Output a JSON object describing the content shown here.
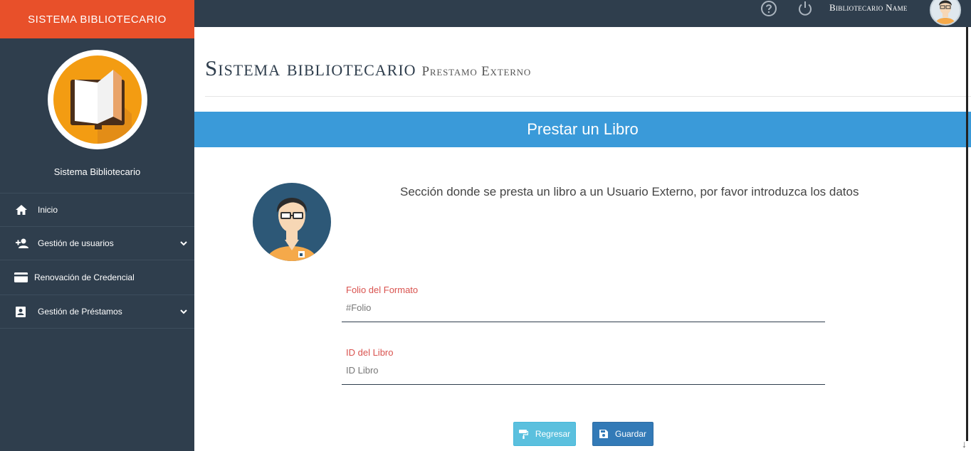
{
  "sidebar": {
    "brand": "SISTEMA BIBLIOTECARIO",
    "logo_title": "Sistema Bibliotecario",
    "items": [
      {
        "label": "Inicio",
        "icon": "home-icon"
      },
      {
        "label": "Gestión de usuarios",
        "icon": "add-user-icon",
        "expandable": true
      },
      {
        "label": "Renovación de Credencial",
        "icon": "credit-card-icon"
      },
      {
        "label": "Gestión de Préstamos",
        "icon": "book-portrait-icon",
        "expandable": true
      }
    ]
  },
  "topbar": {
    "help_icon": "help-circle-icon",
    "power_icon": "power-icon",
    "user_name": "Bibliotecario Name"
  },
  "page": {
    "title": "Sistema bibliotecario",
    "subtitle": "Prestamo Externo"
  },
  "panel": {
    "heading": "Prestar un Libro",
    "description": "Sección donde se presta un libro a un Usuario Externo, por favor introduzca los datos"
  },
  "form": {
    "folio": {
      "label": "Folio del Formato",
      "placeholder": "#Folio",
      "value": ""
    },
    "book_id": {
      "label": "ID del Libro",
      "placeholder": "ID Libro",
      "value": ""
    }
  },
  "buttons": {
    "back": "Regresar",
    "save": "Guardar"
  },
  "colors": {
    "brand": "#e8502a",
    "sidebar": "#2f3e4d",
    "panel_header": "#3a9ad9",
    "label": "#d9534f",
    "btn_back": "#5bc0de",
    "btn_save": "#337ab7"
  }
}
